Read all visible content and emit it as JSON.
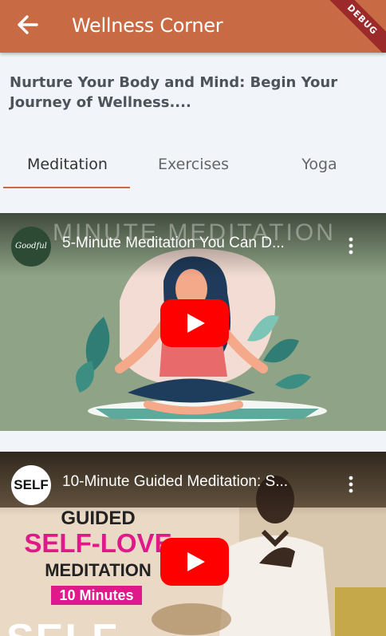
{
  "appbar": {
    "title": "Wellness Corner",
    "debug_label": "DEBUG",
    "color": "#C86B45"
  },
  "intro": {
    "text": "Nurture Your Body and Mind: Begin Your Journey of Wellness...."
  },
  "tabs": [
    {
      "label": "Meditation",
      "active": true
    },
    {
      "label": "Exercises",
      "active": false
    },
    {
      "label": "Yoga",
      "active": false
    }
  ],
  "videos": [
    {
      "title": "5-Minute Meditation You Can D...",
      "channel_logo_text": "Goodful",
      "watermark": "MINUTE MEDITATION",
      "thumb_bg": "#8FA486"
    },
    {
      "title": "10-Minute Guided Meditation: S...",
      "channel_logo_text": "SELF",
      "thumb_lines": [
        "GUIDED",
        "SELF-LOVE",
        "MEDITATION",
        "10 Minutes",
        "SELF"
      ],
      "thumb_bg": "#E8D7C2"
    }
  ],
  "icons": [
    "back-arrow-icon",
    "more-vert-icon",
    "youtube-play-icon"
  ]
}
